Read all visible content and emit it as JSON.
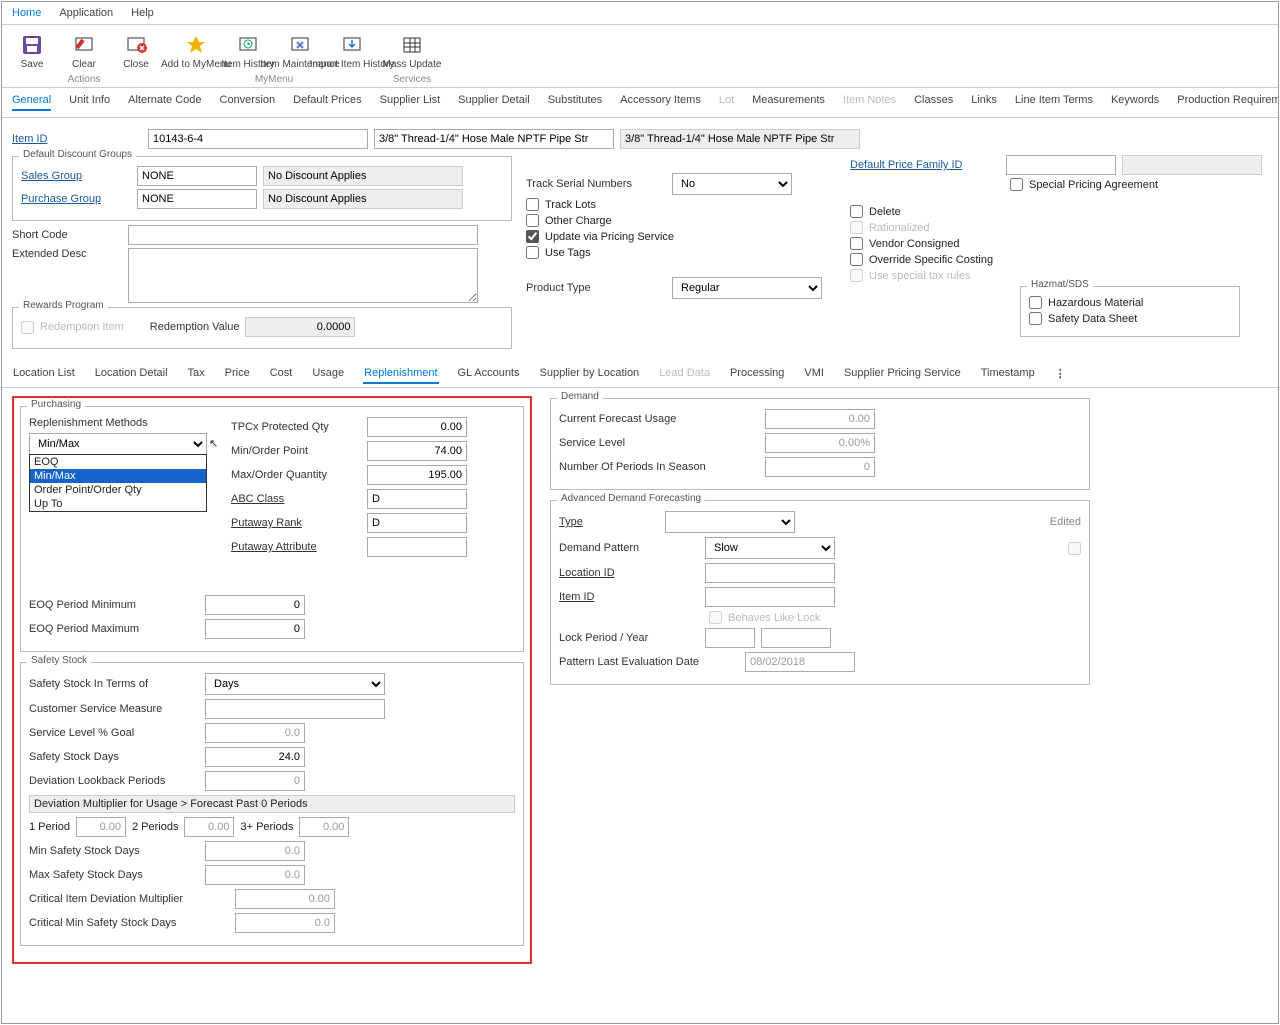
{
  "menubar": {
    "home": "Home",
    "application": "Application",
    "help": "Help"
  },
  "ribbon": {
    "actions_label": "Actions",
    "mymenu_label": "MyMenu",
    "services_label": "Services",
    "save": "Save",
    "clear": "Clear",
    "close": "Close",
    "add_to_mymenu": "Add to MyMenu",
    "item_history": "Item History",
    "item_maintenance": "Item Maintenance",
    "import_item_history": "Import Item History",
    "mass_update": "Mass Update"
  },
  "tabs_top": {
    "general": "General",
    "unit_info": "Unit Info",
    "alternate_code": "Alternate Code",
    "conversion": "Conversion",
    "default_prices": "Default Prices",
    "supplier_list": "Supplier List",
    "supplier_detail": "Supplier Detail",
    "substitutes": "Substitutes",
    "accessory_items": "Accessory Items",
    "lot": "Lot",
    "measurements": "Measurements",
    "item_notes": "Item Notes",
    "classes": "Classes",
    "links": "Links",
    "line_item_terms": "Line Item Terms",
    "keywords": "Keywords",
    "production_requirements": "Production Requirements"
  },
  "item": {
    "id_label": "Item ID",
    "id_value": "10143-6-4",
    "desc1": "3/8\" Thread-1/4\" Hose Male NPTF Pipe Str",
    "desc2": "3/8\" Thread-1/4\" Hose Male NPTF Pipe Str"
  },
  "ddg": {
    "legend": "Default Discount Groups",
    "sales_group_label": "Sales Group",
    "sales_group_value": "NONE",
    "no_discount1": "No Discount Applies",
    "purchase_group_label": "Purchase Group",
    "purchase_group_value": "NONE",
    "no_discount2": "No Discount Applies"
  },
  "short_code_label": "Short Code",
  "extended_desc_label": "Extended Desc",
  "rewards": {
    "legend": "Rewards Program",
    "redemption_item": "Redemption Item",
    "redemption_value_label": "Redemption Value",
    "redemption_value": "0.0000"
  },
  "mid": {
    "track_serial_label": "Track Serial Numbers",
    "track_serial_value": "No",
    "track_lots": "Track Lots",
    "other_charge": "Other Charge",
    "update_pricing": "Update via Pricing Service",
    "use_tags": "Use Tags",
    "product_type_label": "Product Type",
    "product_type_value": "Regular"
  },
  "right": {
    "default_price_family": "Default Price Family ID",
    "special_pricing": "Special Pricing Agreement",
    "delete": "Delete",
    "rationalized": "Rationalized",
    "vendor_consigned": "Vendor Consigned",
    "override_costing": "Override Specific Costing",
    "use_special_tax": "Use special tax rules",
    "hazmat_legend": "Hazmat/SDS",
    "hazardous": "Hazardous Material",
    "sds": "Safety Data Sheet"
  },
  "subtabs": {
    "location_list": "Location List",
    "location_detail": "Location Detail",
    "tax": "Tax",
    "price": "Price",
    "cost": "Cost",
    "usage": "Usage",
    "replenishment": "Replenishment",
    "gl_accounts": "GL Accounts",
    "supplier_by_location": "Supplier by Location",
    "lead_data": "Lead Data",
    "processing": "Processing",
    "vmi": "VMI",
    "supplier_pricing_service": "Supplier Pricing Service",
    "timestamp": "Timestamp"
  },
  "purchasing": {
    "legend": "Purchasing",
    "replenishment_methods_label": "Replenishment Methods",
    "replenishment_select_value": "Min/Max",
    "dd_options": {
      "eoq": "EOQ",
      "minmax": "Min/Max",
      "opoq": "Order Point/Order Qty",
      "upto": "Up To"
    },
    "tpcx_label": "TPCx Protected Qty",
    "tpcx_val": "0.00",
    "minop_label": "Min/Order Point",
    "minop_val": "74.00",
    "maxoq_label": "Max/Order Quantity",
    "maxoq_val": "195.00",
    "abc_label": "ABC Class",
    "abc_val": "D",
    "putaway_rank_label": "Putaway Rank",
    "putaway_rank_val": "D",
    "putaway_attr_label": "Putaway Attribute",
    "putaway_attr_val": "",
    "eoq_min_label": "EOQ Period Minimum",
    "eoq_min_val": "0",
    "eoq_max_label": "EOQ Period Maximum",
    "eoq_max_val": "0"
  },
  "safety": {
    "legend": "Safety Stock",
    "terms_label": "Safety Stock In Terms of",
    "terms_val": "Days",
    "csm_label": "Customer Service Measure",
    "slg_label": "Service Level % Goal",
    "slg_val": "0.0",
    "ssd_label": "Safety Stock Days",
    "ssd_val": "24.0",
    "dlp_label": "Deviation Lookback Periods",
    "dlp_val": "0",
    "dm_header": "Deviation Multiplier for Usage > Forecast Past 0 Periods",
    "p1_label": "1 Period",
    "p1_val": "0.00",
    "p2_label": "2 Periods",
    "p2_val": "0.00",
    "p3_label": "3+ Periods",
    "p3_val": "0.00",
    "minssd_label": "Min Safety Stock Days",
    "minssd_val": "0.0",
    "maxssd_label": "Max Safety Stock Days",
    "maxssd_val": "0.0",
    "cidm_label": "Critical Item Deviation Multiplier",
    "cidm_val": "0.00",
    "cminssd_label": "Critical Min Safety Stock Days",
    "cminssd_val": "0.0"
  },
  "demand": {
    "legend": "Demand",
    "cfu_label": "Current Forecast Usage",
    "cfu_val": "0.00",
    "sl_label": "Service Level",
    "sl_val": "0.00%",
    "npis_label": "Number Of Periods In Season",
    "npis_val": "0"
  },
  "adf": {
    "legend": "Advanced Demand Forecasting",
    "type_label": "Type",
    "type_val": "",
    "edited_label": "Edited",
    "demand_pattern_label": "Demand Pattern",
    "demand_pattern_val": "Slow",
    "location_id_label": "Location ID",
    "item_id_label": "Item ID",
    "behaves_lock": "Behaves Like Lock",
    "lock_period_label": "Lock Period / Year",
    "pattern_eval_label": "Pattern Last Evaluation Date",
    "pattern_eval_val": "08/02/2018"
  }
}
